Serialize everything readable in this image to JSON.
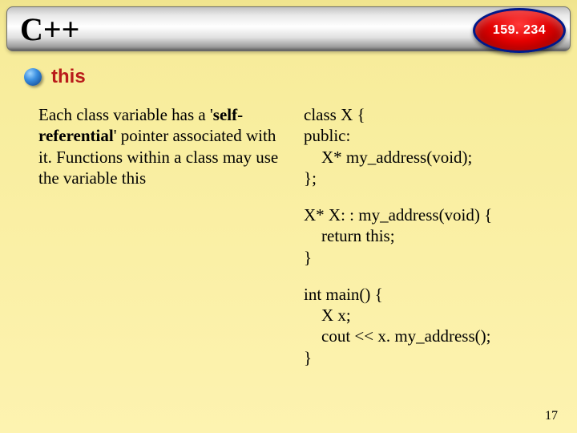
{
  "header": {
    "title": "C++",
    "course_code": "159. 234"
  },
  "section": {
    "heading": "this"
  },
  "left": {
    "p1a": "Each class variable has a '",
    "bold": "self-referential",
    "p1b": "' pointer associated with it. Functions within a class may use the variable this"
  },
  "code": {
    "decl_open": "class X {",
    "decl_public": "public:",
    "decl_method": "X*  my_address(void);",
    "decl_close": "};",
    "def_open": "X*  X: : my_address(void) {",
    "def_return": "return this;",
    "def_close": "}",
    "main_open": "int main() {",
    "main_l1": "X x;",
    "main_l2": "cout << x. my_address();",
    "main_close": "}"
  },
  "page_number": "17"
}
